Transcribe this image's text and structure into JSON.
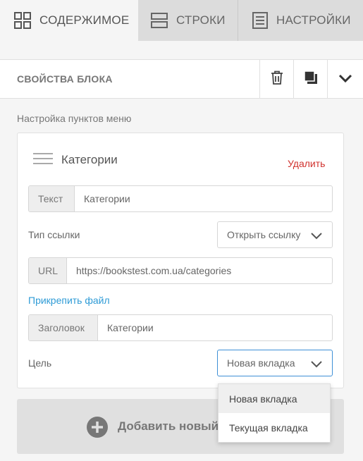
{
  "tabs": [
    {
      "label": "Содержимое",
      "icon": "grid-icon",
      "active": true
    },
    {
      "label": "Строки",
      "icon": "rows-icon",
      "active": false
    },
    {
      "label": "Настройки",
      "icon": "settings-doc-icon",
      "active": false
    }
  ],
  "panel": {
    "title": "Свойства блока",
    "actions": [
      "trash-icon",
      "copy-icon",
      "chevron-down-icon"
    ]
  },
  "section_label": "Настройка пунктов меню",
  "menu_item": {
    "title": "Категории",
    "delete_label": "Удалить",
    "text_addon": "Текст",
    "text_value": "Категории",
    "link_type_label": "Тип ссылки",
    "link_type_value": "Открыть ссылку",
    "url_addon": "URL",
    "url_value": "https://bookstest.com.ua/categories",
    "attach_label": "Прикрепить файл",
    "heading_addon": "Заголовок",
    "heading_value": "Категории",
    "target_label": "Цель",
    "target_value": "Новая вкладка"
  },
  "dropdown": {
    "options": [
      "Новая вкладка",
      "Текущая вкладка"
    ],
    "highlighted": "Новая вкладка"
  },
  "add_button": {
    "label": "Добавить новый"
  },
  "colors": {
    "accent_blue": "#2e9bd6",
    "select_focus": "#3d8fd6",
    "delete_red": "#d0312d"
  }
}
